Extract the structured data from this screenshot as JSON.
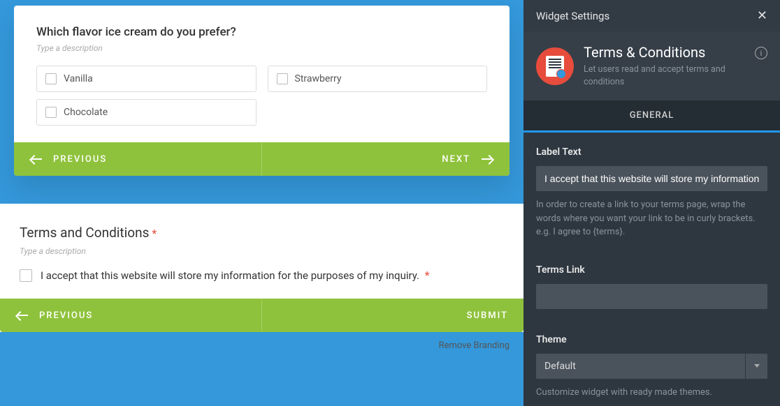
{
  "card1": {
    "question": "Which flavor ice cream do you prefer?",
    "desc_placeholder": "Type a description",
    "options": [
      "Vanilla",
      "Strawberry",
      "Chocolate"
    ],
    "prev": "PREVIOUS",
    "next": "NEXT"
  },
  "card2": {
    "title": "Terms and Conditions",
    "desc_placeholder": "Type a description",
    "accept_text": "I accept that this website will store my information for the purposes of my inquiry.",
    "prev": "PREVIOUS",
    "submit": "SUBMIT"
  },
  "branding": "Remove Branding",
  "sidebar": {
    "header": "Widget Settings",
    "widget_name": "Terms & Conditions",
    "widget_desc": "Let users read and accept terms and conditions",
    "tab": "GENERAL",
    "label_text": {
      "label": "Label Text",
      "value": "I accept that this website will store my information for",
      "help": "In order to create a link to your terms page, wrap the words where you want your link to be in curly brackets. e.g. I agree to {terms}."
    },
    "terms_link": {
      "label": "Terms Link",
      "value": ""
    },
    "theme": {
      "label": "Theme",
      "value": "Default",
      "help": "Customize widget with ready made themes."
    }
  }
}
